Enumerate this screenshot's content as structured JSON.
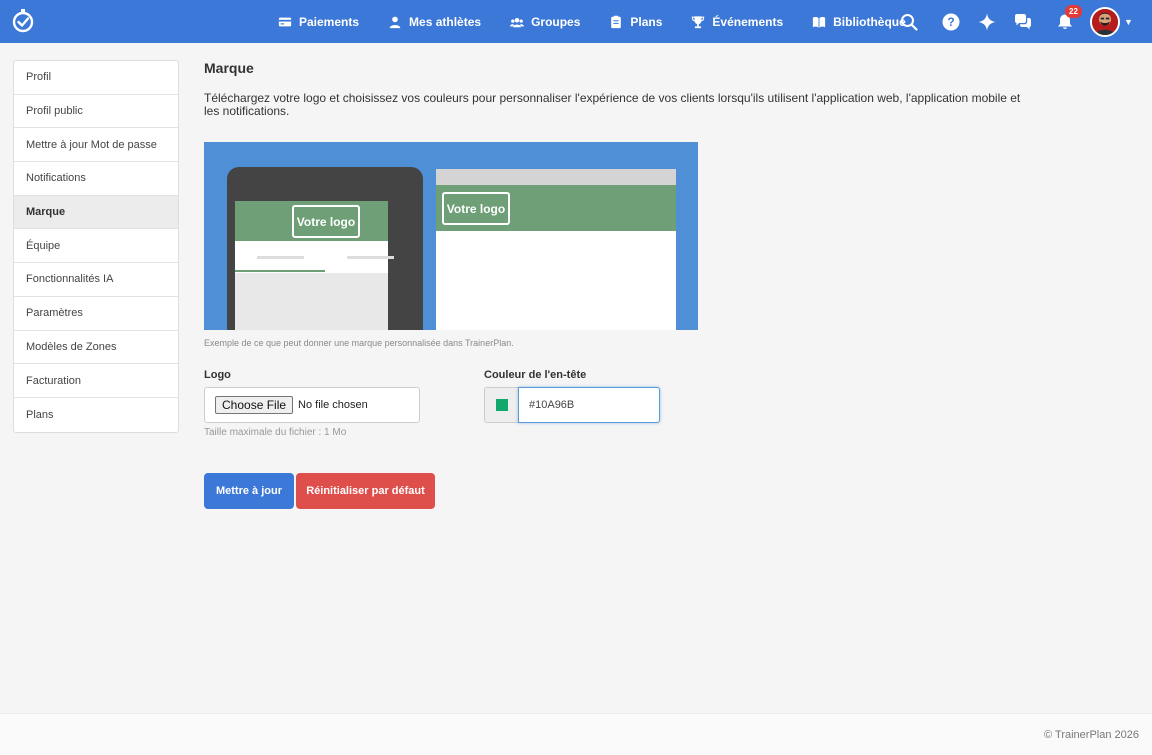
{
  "nav": {
    "items": [
      {
        "label": "Paiements",
        "icon": "credit-card-icon"
      },
      {
        "label": "Mes athlètes",
        "icon": "user-icon"
      },
      {
        "label": "Groupes",
        "icon": "group-icon"
      },
      {
        "label": "Plans",
        "icon": "clipboard-icon"
      },
      {
        "label": "Événements",
        "icon": "trophy-icon"
      },
      {
        "label": "Bibliothèque",
        "icon": "book-icon"
      }
    ],
    "notification_count": "22"
  },
  "sidebar": {
    "items": [
      {
        "label": "Profil"
      },
      {
        "label": "Profil public"
      },
      {
        "label": "Mettre à jour Mot de passe"
      },
      {
        "label": "Notifications"
      },
      {
        "label": "Marque"
      },
      {
        "label": "Équipe"
      },
      {
        "label": "Fonctionnalités IA"
      },
      {
        "label": "Paramètres"
      },
      {
        "label": "Modèles de Zones"
      },
      {
        "label": "Facturation"
      },
      {
        "label": "Plans"
      }
    ],
    "active": "Marque"
  },
  "main": {
    "title": "Marque",
    "description": "Téléchargez votre logo et choisissez vos couleurs pour personnaliser l'expérience de vos clients lorsqu'ils utilisent l'application web, l'application mobile et les notifications.",
    "preview": {
      "phone_logo": "Votre logo",
      "browser_logo": "Votre logo",
      "caption": "Exemple de ce que peut donner une marque personnalisée dans TrainerPlan."
    },
    "logo_field": {
      "label": "Logo",
      "button": "Choose File",
      "status": "No file chosen",
      "help": "Taille maximale du fichier : 1 Mo"
    },
    "color_field": {
      "label": "Couleur de l'en-tête",
      "value": "#10A96B",
      "swatch_color": "#10A96B"
    },
    "buttons": {
      "update": "Mettre à jour",
      "reset": "Réinitialiser par défaut"
    }
  },
  "footer": {
    "text": "© TrainerPlan 2026"
  },
  "colors": {
    "nav": "#3c78d8",
    "primary": "#3c78d8",
    "danger": "#de4e4b",
    "brand_header": "#6e9f77",
    "preview_bg": "#4f8fd6"
  }
}
